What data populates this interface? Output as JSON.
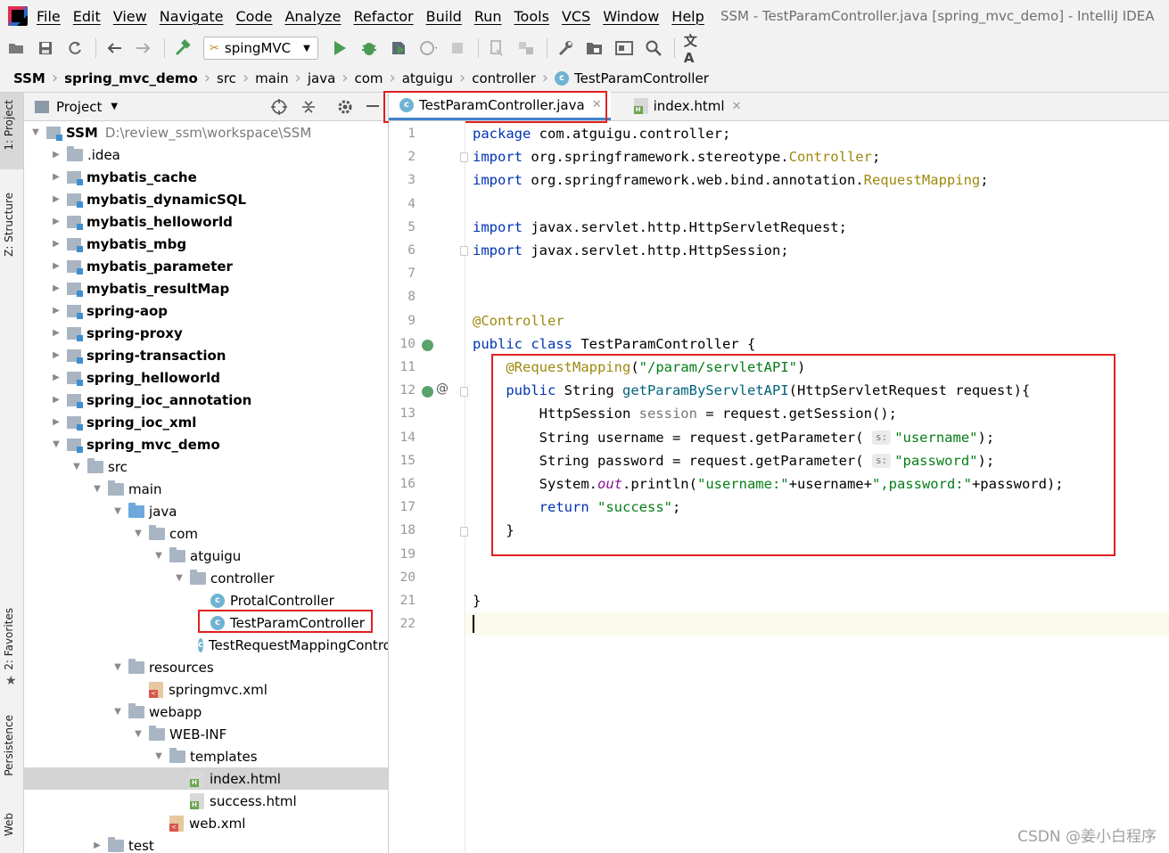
{
  "menubar": {
    "items": [
      "File",
      "Edit",
      "View",
      "Navigate",
      "Code",
      "Analyze",
      "Refactor",
      "Build",
      "Run",
      "Tools",
      "VCS",
      "Window",
      "Help"
    ],
    "title": "SSM - TestParamController.java [spring_mvc_demo] - IntelliJ IDEA"
  },
  "toolbar": {
    "run_config": "spingMVC",
    "icons": [
      "open-icon",
      "save-icon",
      "sync-icon",
      "back-icon",
      "forward-icon",
      "build-hammer-icon",
      "run-icon",
      "debug-icon",
      "coverage-icon",
      "profile-icon",
      "stop-icon",
      "attach-icon",
      "sdk-icon",
      "settings-wrench-icon",
      "project-structure-icon",
      "frame-icon",
      "search-icon",
      "translate-icon"
    ]
  },
  "breadcrumbs": [
    "SSM",
    "spring_mvc_demo",
    "src",
    "main",
    "java",
    "com",
    "atguigu",
    "controller",
    "TestParamController"
  ],
  "side_strip": {
    "labels": [
      "1: Project",
      "Z: Structure",
      "2: Favorites",
      "Persistence",
      "Web"
    ]
  },
  "project_panel": {
    "title": "Project",
    "root_name": "SSM",
    "root_path": "D:\\review_ssm\\workspace\\SSM",
    "tree": [
      {
        "label": ".idea",
        "depth": 1,
        "type": "folder",
        "arrow": "▶",
        "bold": false
      },
      {
        "label": "mybatis_cache",
        "depth": 1,
        "type": "module",
        "arrow": "▶",
        "bold": true
      },
      {
        "label": "mybatis_dynamicSQL",
        "depth": 1,
        "type": "module",
        "arrow": "▶",
        "bold": true
      },
      {
        "label": "mybatis_helloworld",
        "depth": 1,
        "type": "module",
        "arrow": "▶",
        "bold": true
      },
      {
        "label": "mybatis_mbg",
        "depth": 1,
        "type": "module",
        "arrow": "▶",
        "bold": true
      },
      {
        "label": "mybatis_parameter",
        "depth": 1,
        "type": "module",
        "arrow": "▶",
        "bold": true
      },
      {
        "label": "mybatis_resultMap",
        "depth": 1,
        "type": "module",
        "arrow": "▶",
        "bold": true
      },
      {
        "label": "spring-aop",
        "depth": 1,
        "type": "module",
        "arrow": "▶",
        "bold": true
      },
      {
        "label": "spring-proxy",
        "depth": 1,
        "type": "module",
        "arrow": "▶",
        "bold": true
      },
      {
        "label": "spring-transaction",
        "depth": 1,
        "type": "module",
        "arrow": "▶",
        "bold": true
      },
      {
        "label": "spring_helloworld",
        "depth": 1,
        "type": "module",
        "arrow": "▶",
        "bold": true
      },
      {
        "label": "spring_ioc_annotation",
        "depth": 1,
        "type": "module",
        "arrow": "▶",
        "bold": true
      },
      {
        "label": "spring_ioc_xml",
        "depth": 1,
        "type": "module",
        "arrow": "▶",
        "bold": true
      },
      {
        "label": "spring_mvc_demo",
        "depth": 1,
        "type": "module",
        "arrow": "▼",
        "bold": true
      },
      {
        "label": "src",
        "depth": 2,
        "type": "folder",
        "arrow": "▼",
        "bold": false
      },
      {
        "label": "main",
        "depth": 3,
        "type": "folder",
        "arrow": "▼",
        "bold": false
      },
      {
        "label": "java",
        "depth": 4,
        "type": "folder-blue",
        "arrow": "▼",
        "bold": false
      },
      {
        "label": "com",
        "depth": 5,
        "type": "folder",
        "arrow": "▼",
        "bold": false
      },
      {
        "label": "atguigu",
        "depth": 6,
        "type": "folder",
        "arrow": "▼",
        "bold": false
      },
      {
        "label": "controller",
        "depth": 7,
        "type": "folder",
        "arrow": "▼",
        "bold": false
      },
      {
        "label": "ProtalController",
        "depth": 8,
        "type": "class",
        "arrow": "",
        "bold": false
      },
      {
        "label": "TestParamController",
        "depth": 8,
        "type": "class",
        "arrow": "",
        "bold": false,
        "highlight": true
      },
      {
        "label": "TestRequestMappingController",
        "depth": 8,
        "type": "class",
        "arrow": "",
        "bold": false
      },
      {
        "label": "resources",
        "depth": 4,
        "type": "folder",
        "arrow": "▼",
        "bold": false
      },
      {
        "label": "springmvc.xml",
        "depth": 5,
        "type": "xml",
        "arrow": "",
        "bold": false
      },
      {
        "label": "webapp",
        "depth": 4,
        "type": "folder",
        "arrow": "▼",
        "bold": false
      },
      {
        "label": "WEB-INF",
        "depth": 5,
        "type": "folder",
        "arrow": "▼",
        "bold": false
      },
      {
        "label": "templates",
        "depth": 6,
        "type": "folder",
        "arrow": "▼",
        "bold": false
      },
      {
        "label": "index.html",
        "depth": 7,
        "type": "html",
        "arrow": "",
        "bold": false,
        "selected": true
      },
      {
        "label": "success.html",
        "depth": 7,
        "type": "html",
        "arrow": "",
        "bold": false
      },
      {
        "label": "web.xml",
        "depth": 6,
        "type": "xml",
        "arrow": "",
        "bold": false
      },
      {
        "label": "test",
        "depth": 3,
        "type": "folder",
        "arrow": "▶",
        "bold": false
      }
    ]
  },
  "editor": {
    "tabs": [
      {
        "label": "TestParamController.java",
        "active": true
      },
      {
        "label": "index.html",
        "active": false
      }
    ],
    "line_numbers": [
      "1",
      "2",
      "3",
      "4",
      "5",
      "6",
      "7",
      "8",
      "9",
      "10",
      "11",
      "12",
      "13",
      "14",
      "15",
      "16",
      "17",
      "18",
      "19",
      "20",
      "21",
      "22"
    ],
    "current_line": 22,
    "code": [
      [
        [
          "kw",
          "package"
        ],
        [
          "",
          " com.atguigu.controller;"
        ]
      ],
      [
        [
          "kw",
          "import"
        ],
        [
          "",
          " org.springframework.stereotype."
        ],
        [
          "ann",
          "Controller"
        ],
        [
          "",
          ";"
        ]
      ],
      [
        [
          "kw",
          "import"
        ],
        [
          "",
          " org.springframework.web.bind.annotation."
        ],
        [
          "ann",
          "RequestMapping"
        ],
        [
          "",
          ";"
        ]
      ],
      [],
      [
        [
          "kw",
          "import"
        ],
        [
          "",
          " javax.servlet.http.HttpServletRequest;"
        ]
      ],
      [
        [
          "kw",
          "import"
        ],
        [
          "",
          " javax.servlet.http.HttpSession;"
        ]
      ],
      [],
      [],
      [
        [
          "ann",
          "@Controller"
        ]
      ],
      [
        [
          "kw",
          "public class"
        ],
        [
          "",
          " TestParamController {"
        ]
      ],
      [
        [
          "",
          "    "
        ],
        [
          "ann",
          "@RequestMapping"
        ],
        [
          "",
          "("
        ],
        [
          "str",
          "\"/param/servletAPI\""
        ],
        [
          "",
          ")"
        ]
      ],
      [
        [
          "",
          "    "
        ],
        [
          "kw",
          "public"
        ],
        [
          "",
          " String "
        ],
        [
          "method",
          "getParamByServletAPI"
        ],
        [
          "",
          "(HttpServletRequest request){"
        ]
      ],
      [
        [
          "",
          "        HttpSession "
        ],
        [
          "gray",
          "session"
        ],
        [
          "",
          " = request.getSession();"
        ]
      ],
      [
        [
          "",
          "        String username = request.getParameter( "
        ],
        [
          "hint",
          "s:"
        ],
        [
          "str",
          "\"username\""
        ],
        [
          "",
          ");"
        ]
      ],
      [
        [
          "",
          "        String password = request.getParameter( "
        ],
        [
          "hint",
          "s:"
        ],
        [
          "str",
          "\"password\""
        ],
        [
          "",
          ");"
        ]
      ],
      [
        [
          "",
          "        System."
        ],
        [
          "fld",
          "out"
        ],
        [
          "",
          ".println("
        ],
        [
          "str",
          "\"username:\""
        ],
        [
          "",
          "+username+"
        ],
        [
          "str",
          "\",password:\""
        ],
        [
          "",
          "+password);"
        ]
      ],
      [
        [
          "",
          "        "
        ],
        [
          "kw",
          "return"
        ],
        [
          "",
          " "
        ],
        [
          "str",
          "\"success\""
        ],
        [
          "",
          ";"
        ]
      ],
      [
        [
          "",
          "    }"
        ]
      ],
      [],
      [],
      [
        [
          "",
          "}"
        ]
      ],
      []
    ]
  },
  "watermark": "CSDN @姜小白程序",
  "colors": {
    "keyword": "#0033b3",
    "annotation": "#9e880d",
    "string": "#067d17",
    "highlight_box": "#e02020",
    "tab_underline": "#4083c9"
  }
}
